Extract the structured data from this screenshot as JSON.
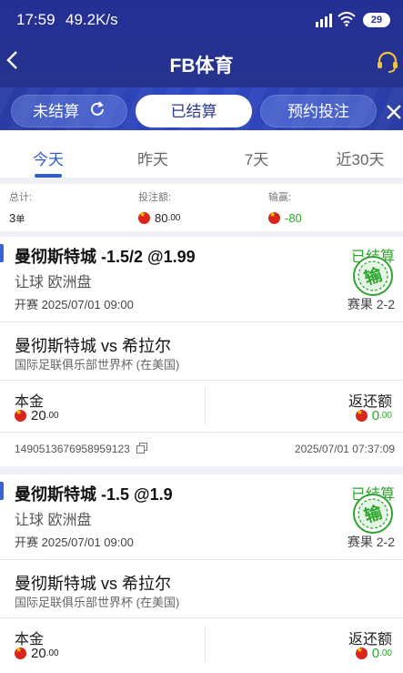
{
  "status_bar": {
    "time": "17:59",
    "speed": "49.2K/s",
    "battery": "29"
  },
  "header": {
    "title": "FB体育"
  },
  "bet_tabs": [
    {
      "label": "未结算"
    },
    {
      "label": "已结算"
    },
    {
      "label": "预约投注"
    }
  ],
  "date_tabs": [
    {
      "label": "今天"
    },
    {
      "label": "昨天"
    },
    {
      "label": "7天"
    },
    {
      "label": "近30天"
    }
  ],
  "summary": {
    "total_label": "总计:",
    "total_count": "3",
    "total_unit": "单",
    "stake_label": "投注额:",
    "stake_int": "80",
    "stake_dec": ".00",
    "winloss_label": "输赢:",
    "winloss_value": "-80"
  },
  "bets": [
    {
      "pick": "曼彻斯特城 -1.5/2 @1.99",
      "status": "已结算",
      "market": "让球 欧洲盘",
      "start": "开赛 2025/07/01 09:00",
      "result": "赛果 2-2",
      "stamp": "输",
      "match": "曼彻斯特城 vs 希拉尔",
      "league": "国际足联俱乐部世界杯 (在美国)",
      "principal_label": "本金",
      "principal_int": "20",
      "principal_dec": ".00",
      "return_label": "返还额",
      "return_int": "0",
      "return_dec": ".00",
      "order_id": "1490513676958959123",
      "settled_time": "2025/07/01 07:37:09"
    },
    {
      "pick": "曼彻斯特城 -1.5 @1.9",
      "status": "已结算",
      "market": "让球 欧洲盘",
      "start": "开赛 2025/07/01 09:00",
      "result": "赛果 2-2",
      "stamp": "输",
      "match": "曼彻斯特城 vs 希拉尔",
      "league": "国际足联俱乐部世界杯 (在美国)",
      "principal_label": "本金",
      "principal_int": "20",
      "principal_dec": ".00",
      "return_label": "返还额",
      "return_int": "0",
      "return_dec": ".00"
    }
  ],
  "colors": {
    "accent": "#2f5bd3",
    "header": "#26338f",
    "win_green": "#2da52d",
    "flag_red": "#d8261b"
  }
}
